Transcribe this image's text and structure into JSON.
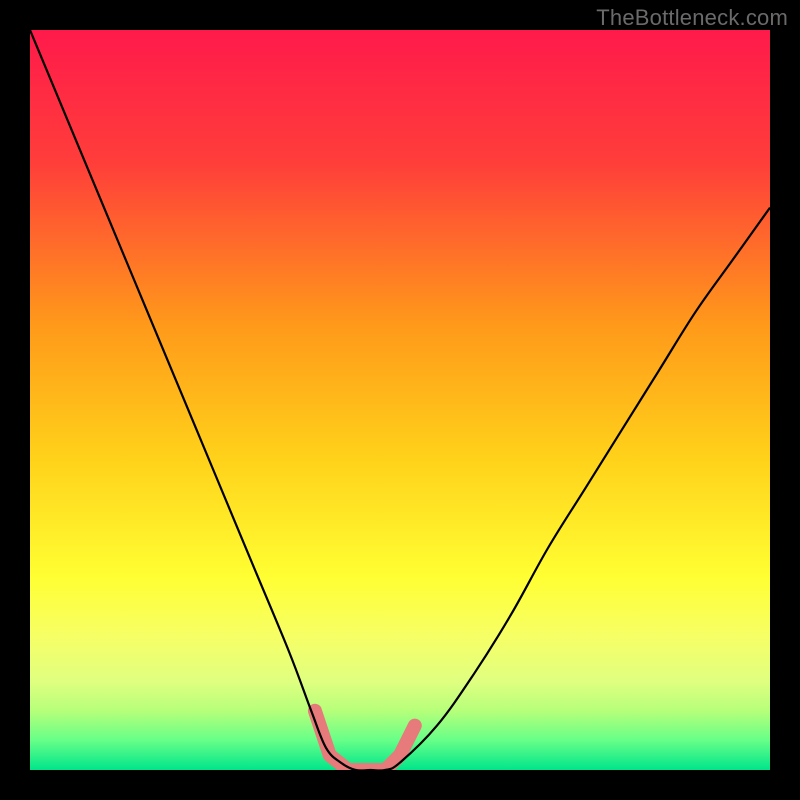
{
  "watermark": "TheBottleneck.com",
  "chart_data": {
    "type": "line",
    "title": "",
    "xlabel": "",
    "ylabel": "",
    "xlim": [
      0,
      100
    ],
    "ylim": [
      0,
      100
    ],
    "annotations": [],
    "grid": false,
    "legend": false,
    "gradient_stops": [
      {
        "offset": 0.0,
        "color": "#ff1a4b"
      },
      {
        "offset": 0.18,
        "color": "#ff3e3a"
      },
      {
        "offset": 0.4,
        "color": "#ff9a1a"
      },
      {
        "offset": 0.58,
        "color": "#ffd21a"
      },
      {
        "offset": 0.74,
        "color": "#ffff33"
      },
      {
        "offset": 0.82,
        "color": "#f6ff66"
      },
      {
        "offset": 0.88,
        "color": "#e0ff80"
      },
      {
        "offset": 0.92,
        "color": "#b6ff7a"
      },
      {
        "offset": 0.96,
        "color": "#66ff88"
      },
      {
        "offset": 1.0,
        "color": "#00e58a"
      }
    ],
    "series": [
      {
        "name": "bottleneck-curve",
        "color": "#000000",
        "x": [
          0,
          5,
          10,
          15,
          20,
          25,
          30,
          35,
          38,
          40,
          42,
          44,
          46,
          48,
          50,
          55,
          60,
          65,
          70,
          75,
          80,
          85,
          90,
          95,
          100
        ],
        "y": [
          100,
          88,
          76,
          64,
          52,
          40,
          28,
          16,
          8,
          3,
          1,
          0,
          0,
          0,
          1,
          6,
          13,
          21,
          30,
          38,
          46,
          54,
          62,
          69,
          76
        ]
      }
    ],
    "markers": {
      "name": "highlight-bracket",
      "color": "#e77a7a",
      "stroke_width": 14,
      "points": [
        {
          "x": 38.5,
          "y": 8
        },
        {
          "x": 40.5,
          "y": 2
        },
        {
          "x": 43.0,
          "y": 0
        },
        {
          "x": 48.0,
          "y": 0
        },
        {
          "x": 50.0,
          "y": 2
        },
        {
          "x": 52.0,
          "y": 6
        }
      ]
    }
  }
}
